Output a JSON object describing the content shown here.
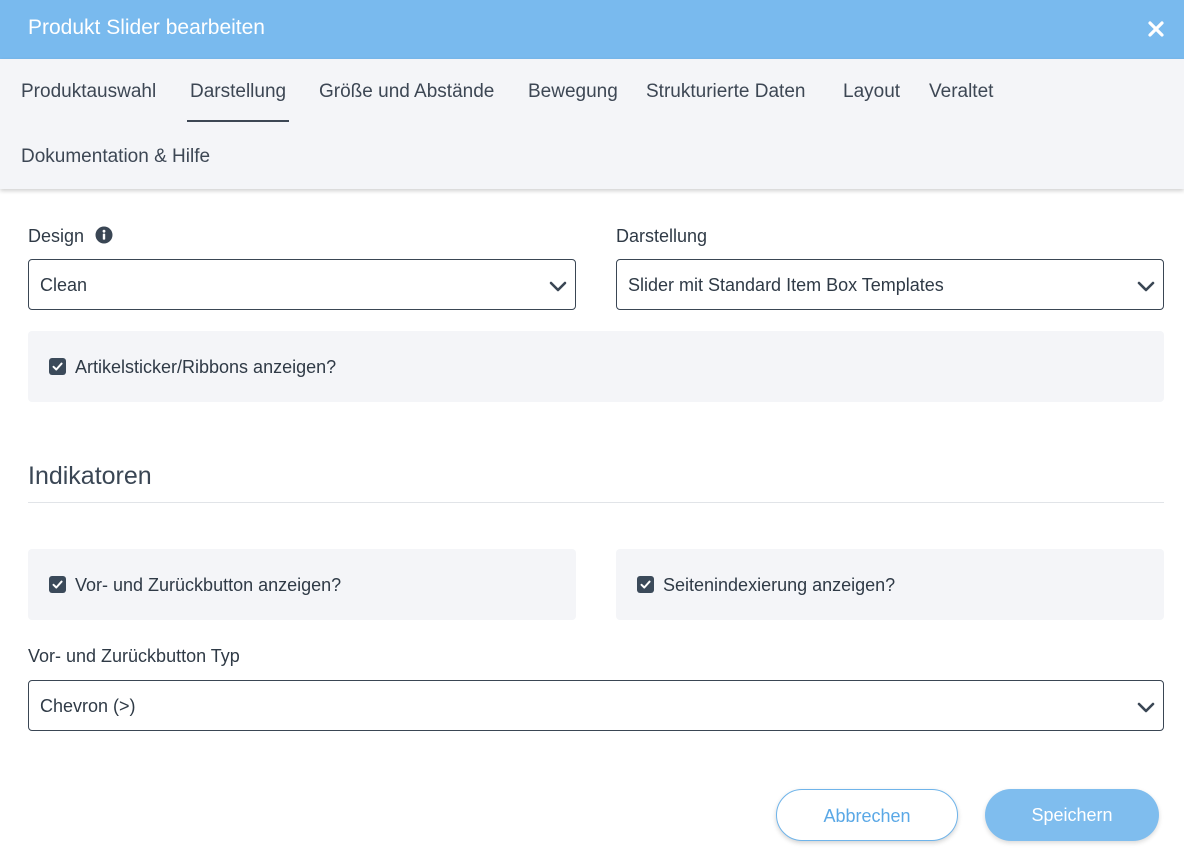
{
  "dialog": {
    "title": "Produkt Slider bearbeiten",
    "close_icon": "close-icon"
  },
  "tabs": [
    {
      "label": "Produktauswahl",
      "active": false
    },
    {
      "label": "Darstellung",
      "active": true
    },
    {
      "label": "Größe und Abstände",
      "active": false
    },
    {
      "label": "Bewegung",
      "active": false
    },
    {
      "label": "Strukturierte Daten",
      "active": false
    },
    {
      "label": "Layout",
      "active": false
    },
    {
      "label": "Veraltet",
      "active": false
    },
    {
      "label": "Dokumentation & Hilfe",
      "active": false
    }
  ],
  "form": {
    "design": {
      "label": "Design",
      "value": "Clean",
      "info_icon": "info-icon"
    },
    "darstellung": {
      "label": "Darstellung",
      "value": "Slider mit Standard Item Box Templates"
    },
    "sticker_checkbox": {
      "label": "Artikelsticker/Ribbons anzeigen?",
      "checked": true
    }
  },
  "indicators": {
    "title": "Indikatoren",
    "prev_next_checkbox": {
      "label": "Vor- und Zurückbutton anzeigen?",
      "checked": true
    },
    "page_index_checkbox": {
      "label": "Seitenindexierung anzeigen?",
      "checked": true
    },
    "button_type": {
      "label": "Vor- und Zurückbutton Typ",
      "value": "Chevron (>)"
    }
  },
  "footer": {
    "cancel_label": "Abbrechen",
    "save_label": "Speichern"
  },
  "colors": {
    "header_bg": "#79baee",
    "tabs_bg": "#f4f5f8",
    "panel_bg": "#f4f5f8",
    "checkbox": "#3b4a5a",
    "accent": "#5aa8e6",
    "save_bg": "#7fbdee"
  }
}
